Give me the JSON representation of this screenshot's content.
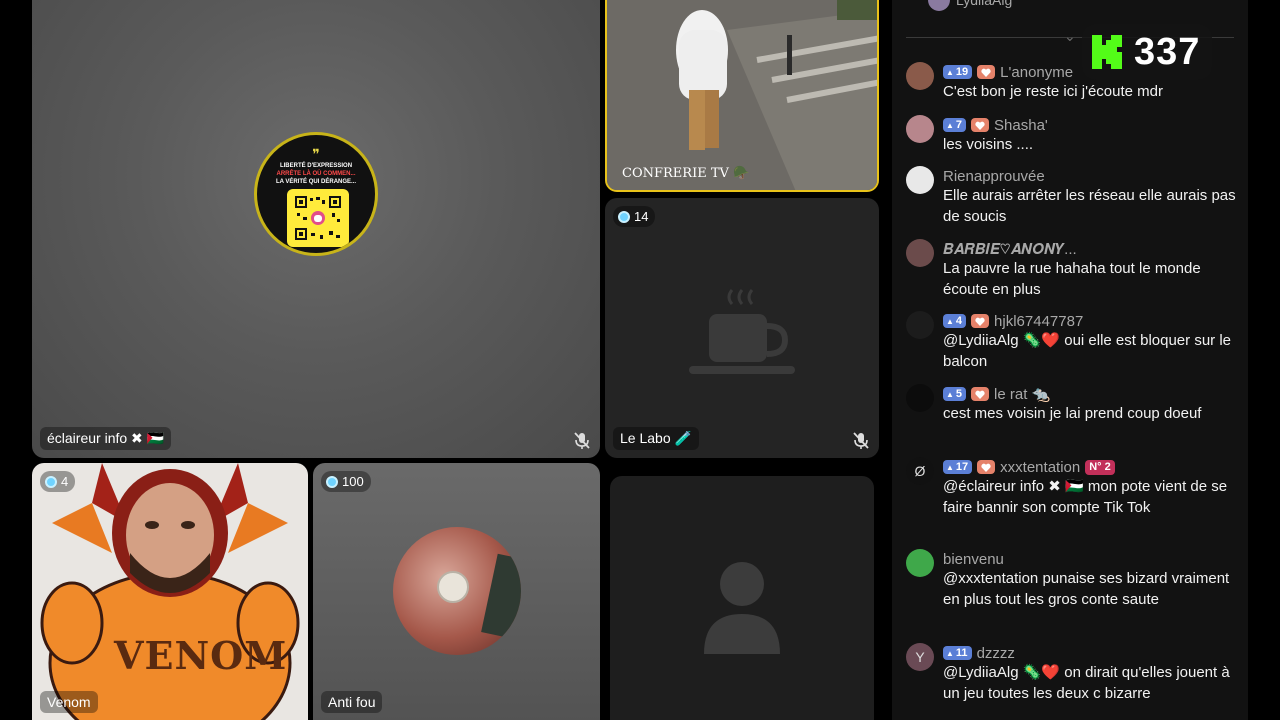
{
  "tiles": {
    "main": {
      "name": "éclaireur info",
      "flags": "✖ 🇵🇸",
      "qr_title_line1": "LIBERTÉ D'EXPRESSION",
      "qr_title_line2": "ARRÊTE LÀ OÙ COMMEN...",
      "qr_title_line3": "LA VÉRITÉ QUI DÉRANGE..."
    },
    "top_right": {
      "name": "CONFRERIE TV 🪖"
    },
    "le_labo": {
      "name": "Le Labo 🧪",
      "viewers": "14"
    },
    "venom": {
      "name": "Venom",
      "viewers": "4",
      "art_text": "VENOM"
    },
    "anti_fou": {
      "name": "Anti fou",
      "viewers": "100"
    }
  },
  "viewer_count": {
    "value": "337",
    "logo_letter": "K"
  },
  "chat": {
    "top_partial_user": "LydiiaAlg",
    "messages": [
      {
        "user": "L'anonyme",
        "level": "19",
        "heart": true,
        "text": "C'est bon je reste ici j'écoute mdr",
        "avatar_color": "#8a5a4a"
      },
      {
        "user": "Shasha'",
        "level": "7",
        "heart": true,
        "text": "les voisins ....",
        "avatar_color": "#b7868c"
      },
      {
        "user": "Rienapprouvée",
        "text": "Elle aurais arrêter les réseau elle aurais pas de soucis",
        "avatar_color": "#e8e8e8"
      },
      {
        "user": "𝑩𝑨𝑹𝑩𝑰𝑬♡𝑨𝑵𝑶𝑵𝒀...",
        "text": "La pauvre la rue hahaha tout le monde écoute en plus",
        "avatar_color": "#6b4b4b"
      },
      {
        "user": "hjkl67447787",
        "level": "4",
        "heart": true,
        "text": "@LydiiaAlg 🦠❤️ oui elle est bloquer sur le balcon",
        "avatar_color": "#1c1c1c"
      },
      {
        "user": "le rat 🐀",
        "level": "5",
        "heart": true,
        "text": "cest mes voisin je lai prend coup doeuf",
        "avatar_color": "#0c0c0c"
      },
      {
        "user": "xxxtentation",
        "level": "17",
        "heart": true,
        "rank": "N° 2",
        "text": "@éclaireur info ✖ 🇵🇸 mon pote vient de se faire bannir son compte Tik Tok",
        "avatar_color": "#111111",
        "avatar_glyph": "Ø"
      },
      {
        "user": "bienvenu",
        "text": "@xxxtentation punaise ses bizard vraiment en plus tout les gros conte saute",
        "avatar_color": "#3fa84a"
      },
      {
        "user": "dzzzz",
        "level": "11",
        "text": "@LydiiaAlg 🦠❤️ on dirait qu'elles jouent à un jeu toutes les deux c bizarre",
        "avatar_color": "#6a4a55",
        "avatar_glyph": "Y"
      }
    ]
  }
}
